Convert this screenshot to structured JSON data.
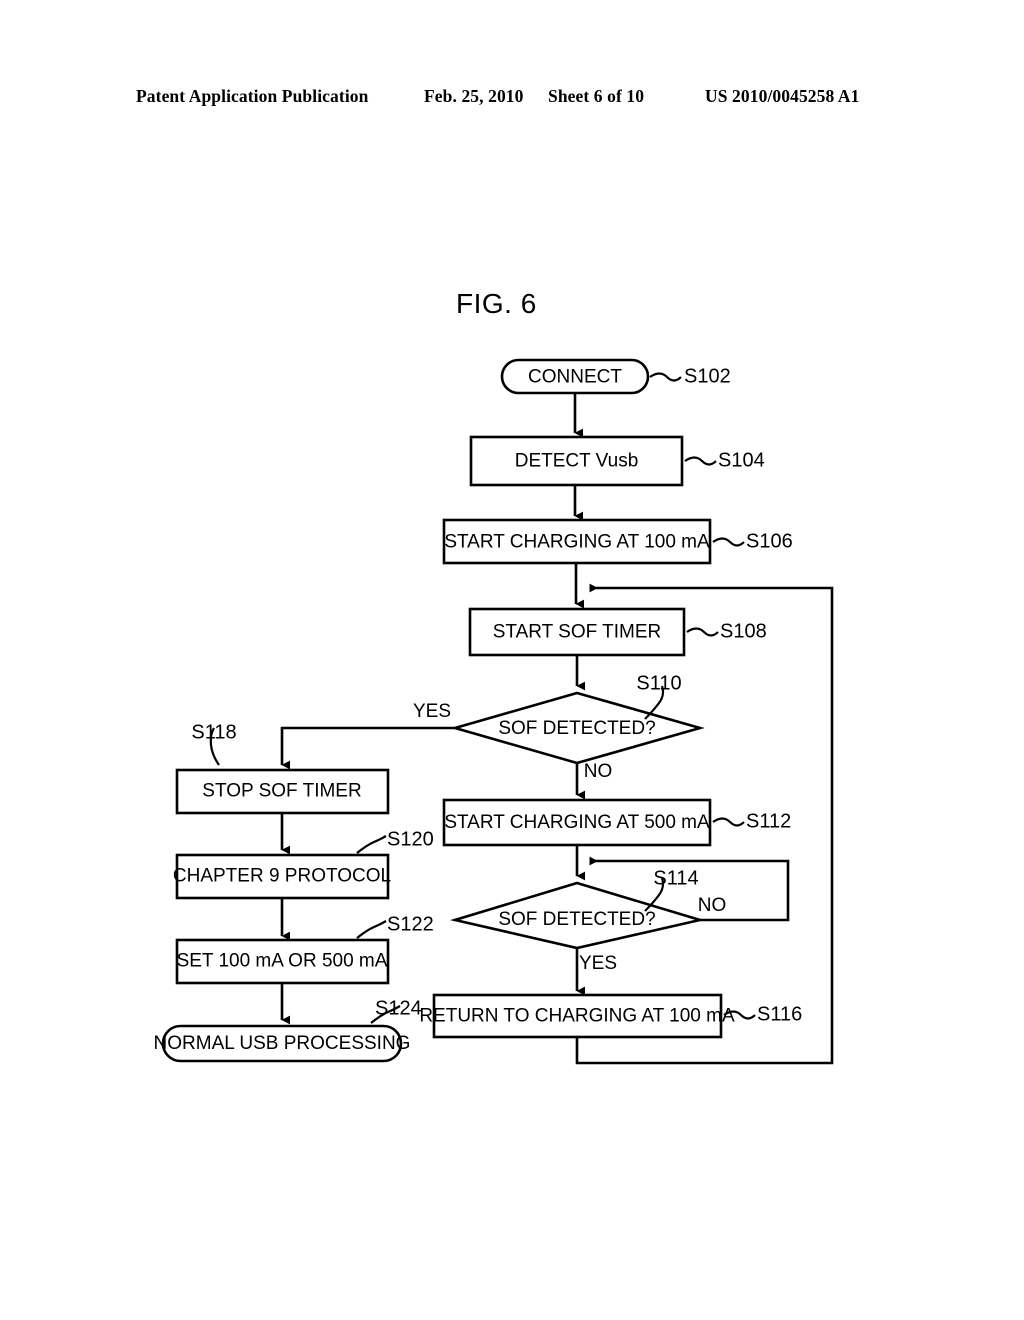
{
  "header": {
    "publication": "Patent Application Publication",
    "date": "Feb. 25, 2010",
    "sheet": "Sheet 6 of 10",
    "patent_number": "US 2010/0045258 A1"
  },
  "figure": {
    "title": "FIG. 6",
    "nodes": [
      {
        "id": "S102",
        "label": "CONNECT",
        "shape": "terminator"
      },
      {
        "id": "S104",
        "label": "DETECT Vusb",
        "shape": "process"
      },
      {
        "id": "S106",
        "label": "START CHARGING AT 100 mA",
        "shape": "process"
      },
      {
        "id": "S108",
        "label": "START SOF TIMER",
        "shape": "process"
      },
      {
        "id": "S110",
        "label": "SOF DETECTED?",
        "shape": "decision"
      },
      {
        "id": "S112",
        "label": "START CHARGING AT 500 mA",
        "shape": "process"
      },
      {
        "id": "S114",
        "label": "SOF DETECTED?",
        "shape": "decision"
      },
      {
        "id": "S116",
        "label": "RETURN TO CHARGING AT 100 mA",
        "shape": "process"
      },
      {
        "id": "S118",
        "label": "STOP SOF TIMER",
        "shape": "process"
      },
      {
        "id": "S120",
        "label": "CHAPTER 9 PROTOCOL",
        "shape": "process"
      },
      {
        "id": "S122",
        "label": "SET 100 mA OR 500 mA",
        "shape": "process"
      },
      {
        "id": "S124",
        "label": "NORMAL USB PROCESSING",
        "shape": "terminator"
      }
    ],
    "branches": {
      "s110_yes": "YES",
      "s110_no": "NO",
      "s114_no": "NO",
      "s114_yes": "YES"
    }
  }
}
